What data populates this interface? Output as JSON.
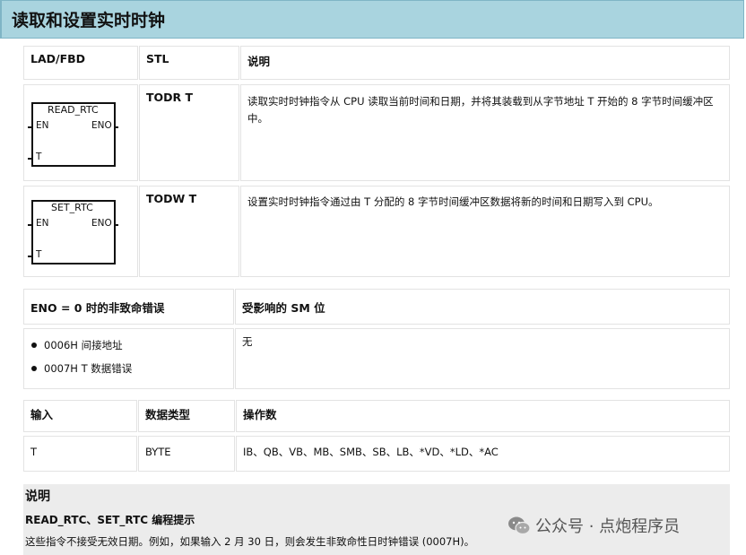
{
  "header": {
    "title": "读取和设置实时时钟"
  },
  "instr_table": {
    "headers": [
      "LAD/FBD",
      "STL",
      "说明"
    ],
    "rows": [
      {
        "block_name": "READ_RTC",
        "pin_en": "EN",
        "pin_eno": "ENO",
        "pin_t": "T",
        "stl": "TODR  T",
        "desc": "读取实时时钟指令从 CPU 读取当前时间和日期，并将其装载到从字节地址 T 开始的 8 字节时间缓冲区中。"
      },
      {
        "block_name": "SET_RTC",
        "pin_en": "EN",
        "pin_eno": "ENO",
        "pin_t": "T",
        "stl": "TODW  T",
        "desc": "设置实时时钟指令通过由 T 分配的 8 字节时间缓冲区数据将新的时间和日期写入到 CPU。"
      }
    ]
  },
  "error_table": {
    "headers": [
      "ENO = 0 时的非致命错误",
      "受影响的 SM 位"
    ],
    "errors": [
      "0006H 间接地址",
      "0007H T 数据错误"
    ],
    "sm": "无"
  },
  "operand_table": {
    "headers": [
      "输入",
      "数据类型",
      "操作数"
    ],
    "row": {
      "input": "T",
      "type": "BYTE",
      "operands": "IB、QB、VB、MB、SMB、SB、LB、*VD、*LD、*AC"
    }
  },
  "note": {
    "title": "说明",
    "subtitle": "READ_RTC、SET_RTC 编程提示",
    "text": "这些指令不接受无效日期。例如，如果输入 2 月 30 日，则会发生非致命性日时钟错误 (0007H)。"
  },
  "watermark": {
    "text": "公众号 · 点炮程序员",
    "icon": "wechat-icon"
  }
}
